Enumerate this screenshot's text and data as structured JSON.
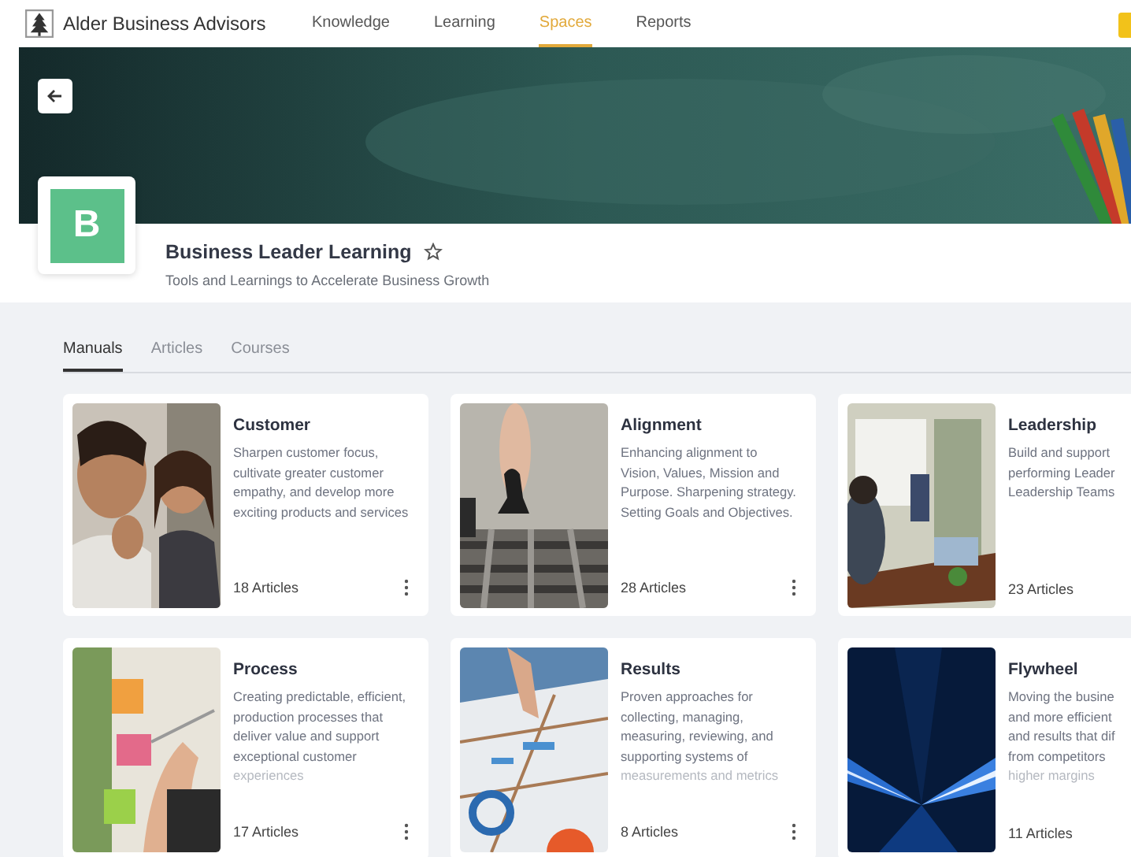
{
  "nav": {
    "brand": "Alder Business Advisors",
    "items": [
      {
        "label": "Knowledge",
        "selected": false
      },
      {
        "label": "Learning",
        "selected": false
      },
      {
        "label": "Spaces",
        "selected": true
      },
      {
        "label": "Reports",
        "selected": false
      }
    ]
  },
  "space": {
    "logo_letter": "B",
    "title": "Business Leader Learning",
    "starred": false,
    "subtitle": "Tools and Learnings to Accelerate Business Growth"
  },
  "tabs": [
    {
      "label": "Manuals",
      "selected": true
    },
    {
      "label": "Articles",
      "selected": false
    },
    {
      "label": "Courses",
      "selected": false
    }
  ],
  "manuals": [
    {
      "title": "Customer",
      "lines": [
        {
          "text": "Sharpen customer focus,",
          "faded": false
        },
        {
          "text": "cultivate greater customer",
          "faded": false
        },
        {
          "text": "empathy, and develop more",
          "faded": false
        },
        {
          "text": "exciting products and services",
          "faded": false
        }
      ],
      "count": "18 Articles"
    },
    {
      "title": "Alignment",
      "lines": [
        {
          "text": "Enhancing alignment to",
          "faded": false
        },
        {
          "text": "Vision, Values, Mission and",
          "faded": false
        },
        {
          "text": "Purpose. Sharpening strategy.",
          "faded": false
        },
        {
          "text": "Setting Goals and Objectives.",
          "faded": false
        }
      ],
      "count": "28 Articles"
    },
    {
      "title": "Leadership",
      "lines": [
        {
          "text": "Build and support",
          "faded": false
        },
        {
          "text": "performing Leader",
          "faded": false
        },
        {
          "text": "Leadership Teams",
          "faded": false
        }
      ],
      "count": "23 Articles"
    },
    {
      "title": "Process",
      "lines": [
        {
          "text": "Creating predictable, efficient,",
          "faded": false
        },
        {
          "text": "production processes that",
          "faded": false
        },
        {
          "text": "deliver value and support",
          "faded": false
        },
        {
          "text": "exceptional customer",
          "faded": false
        },
        {
          "text": "experiences",
          "faded": true
        }
      ],
      "count": "17 Articles"
    },
    {
      "title": "Results",
      "lines": [
        {
          "text": "Proven approaches for",
          "faded": false
        },
        {
          "text": "collecting, managing,",
          "faded": false
        },
        {
          "text": "measuring, reviewing, and",
          "faded": false
        },
        {
          "text": "supporting systems of",
          "faded": false
        },
        {
          "text": "measurements and metrics",
          "faded": true
        }
      ],
      "count": "8 Articles"
    },
    {
      "title": "Flywheel",
      "lines": [
        {
          "text": "Moving the busine",
          "faded": false
        },
        {
          "text": "and more efficient",
          "faded": false
        },
        {
          "text": "and results that dif",
          "faded": false
        },
        {
          "text": "from competitors",
          "faded": false
        },
        {
          "text": "higher margins",
          "faded": true
        }
      ],
      "count": "11 Articles"
    }
  ]
}
